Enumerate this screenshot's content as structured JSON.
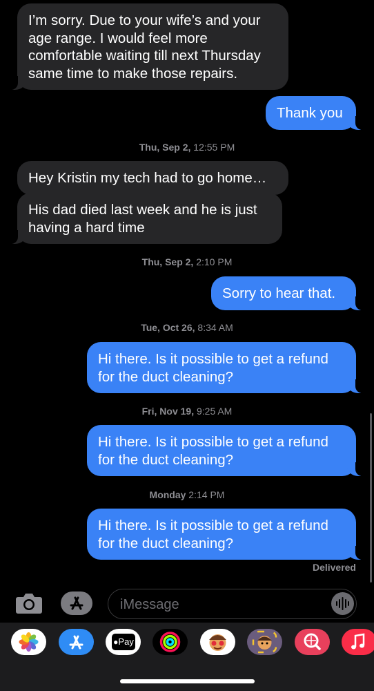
{
  "messages": [
    {
      "dir": "in",
      "text": "I’m sorry.  Due to your wife’s and your\nage range.  I would feel more\ncomfortable waiting till next Thursday\nsame time to make those repairs."
    },
    {
      "dir": "out",
      "text": "Thank you"
    },
    {
      "dir": "stamp",
      "day": "Thu, Sep 2,",
      "time": " 12:55 PM"
    },
    {
      "dir": "in",
      "text": "Hey Kristin my tech had to go home…"
    },
    {
      "dir": "in",
      "text": "His dad died last week and he is just\nhaving a hard time"
    },
    {
      "dir": "stamp",
      "day": "Thu, Sep 2,",
      "time": " 2:10 PM"
    },
    {
      "dir": "out",
      "text": "Sorry to hear that."
    },
    {
      "dir": "stamp",
      "day": "Tue, Oct 26,",
      "time": " 8:34 AM"
    },
    {
      "dir": "out",
      "text": "Hi there. Is it possible to get a refund\nfor the duct cleaning?"
    },
    {
      "dir": "stamp",
      "day": "Fri, Nov 19,",
      "time": " 9:25 AM"
    },
    {
      "dir": "out",
      "text": "Hi there. Is it possible to get a refund\nfor the duct cleaning?"
    },
    {
      "dir": "stamp",
      "day": "Monday",
      "time": " 2:14 PM"
    },
    {
      "dir": "out",
      "text": "Hi there. Is it possible to get a refund\nfor the duct cleaning?"
    }
  ],
  "status": {
    "delivered": "Delivered"
  },
  "composer": {
    "placeholder": "iMessage"
  },
  "drawer": {
    "apple_pay_label": "Pay",
    "apps": [
      {
        "name": "photos-app-icon",
        "color": "#ffffff"
      },
      {
        "name": "app-store-app-icon",
        "color": "#2f8cf5"
      },
      {
        "name": "apple-pay-app-icon",
        "color": "#ffffff"
      },
      {
        "name": "activity-app-icon",
        "color": "#000000"
      },
      {
        "name": "memoji-stickers-icon",
        "color": "#ffffff"
      },
      {
        "name": "memoji-app-icon",
        "color": "#6a5c7d"
      },
      {
        "name": "image-search-app-icon",
        "color": "#e8405c"
      },
      {
        "name": "music-app-icon",
        "color": "#fa2d48"
      }
    ]
  }
}
